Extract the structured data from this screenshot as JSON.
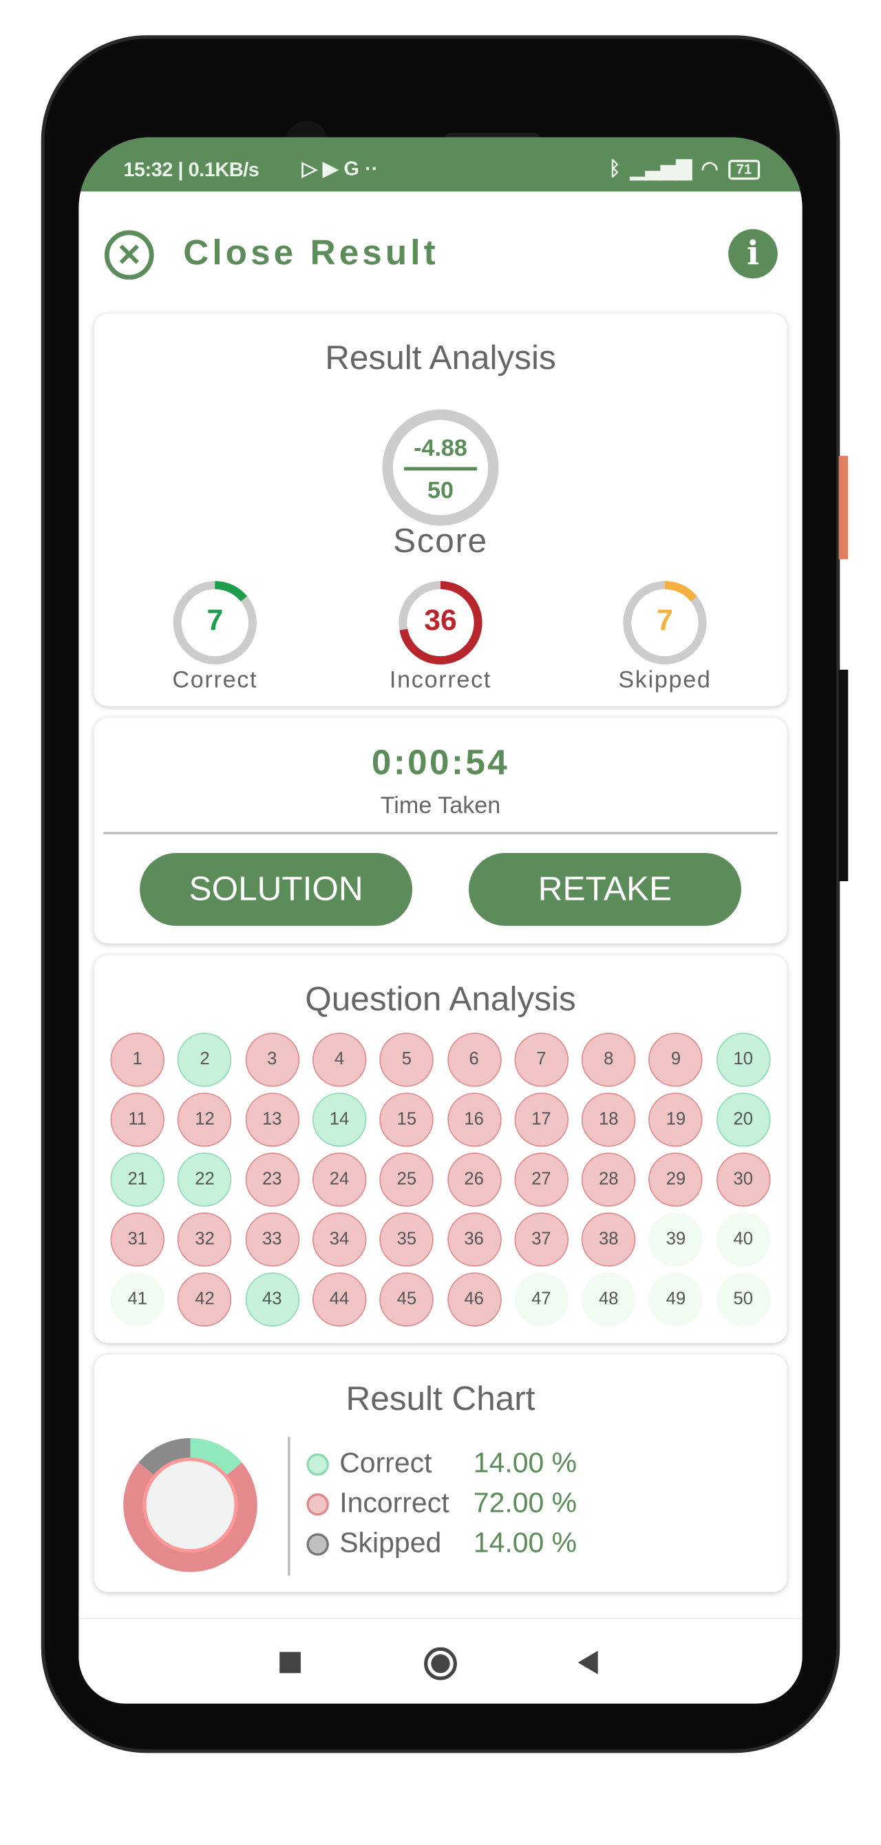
{
  "status_bar": {
    "left": "15:32 | 0.1KB/s",
    "icons": [
      "play-store-icon",
      "play-icon",
      "google-icon",
      "more-dots-icon"
    ],
    "right_icons": [
      "bluetooth-icon",
      "signal-icon",
      "wifi-icon"
    ],
    "battery": "71"
  },
  "header": {
    "title": "Close Result",
    "close_icon": "close-circle-icon",
    "info_icon": "info-icon"
  },
  "result_analysis": {
    "title": "Result Analysis",
    "score": "-4.88",
    "total": "50",
    "score_label": "Score",
    "stats": [
      {
        "label": "Correct",
        "value": "7",
        "fraction": 0.14,
        "color": "#1e9e4a"
      },
      {
        "label": "Incorrect",
        "value": "36",
        "fraction": 0.72,
        "color": "#b7262c"
      },
      {
        "label": "Skipped",
        "value": "7",
        "fraction": 0.14,
        "color": "#f5b041"
      }
    ]
  },
  "time": {
    "value": "0:00:54",
    "label": "Time Taken",
    "solution": "SOLUTION",
    "retake": "RETAKE"
  },
  "question_analysis": {
    "title": "Question Analysis",
    "statuses": [
      "i",
      "c",
      "i",
      "i",
      "i",
      "i",
      "i",
      "i",
      "i",
      "c",
      "i",
      "i",
      "i",
      "c",
      "i",
      "i",
      "i",
      "i",
      "i",
      "c",
      "c",
      "c",
      "i",
      "i",
      "i",
      "i",
      "i",
      "i",
      "i",
      "i",
      "i",
      "i",
      "i",
      "i",
      "i",
      "i",
      "i",
      "i",
      "s",
      "s",
      "s",
      "i",
      "c",
      "i",
      "i",
      "i",
      "s",
      "s",
      "s",
      "s"
    ]
  },
  "chart_data": {
    "type": "pie",
    "title": "Result Chart",
    "categories": [
      "Correct",
      "Incorrect",
      "Skipped"
    ],
    "values": [
      14.0,
      72.0,
      14.0
    ],
    "value_labels": [
      "14.00 %",
      "72.00 %",
      "14.00 %"
    ],
    "colors": [
      "#90e8bd",
      "#e48a8c",
      "#8a8a8a"
    ],
    "legend": "right"
  },
  "nav": {
    "icons": [
      "recent-apps-icon",
      "home-icon",
      "back-icon"
    ]
  }
}
